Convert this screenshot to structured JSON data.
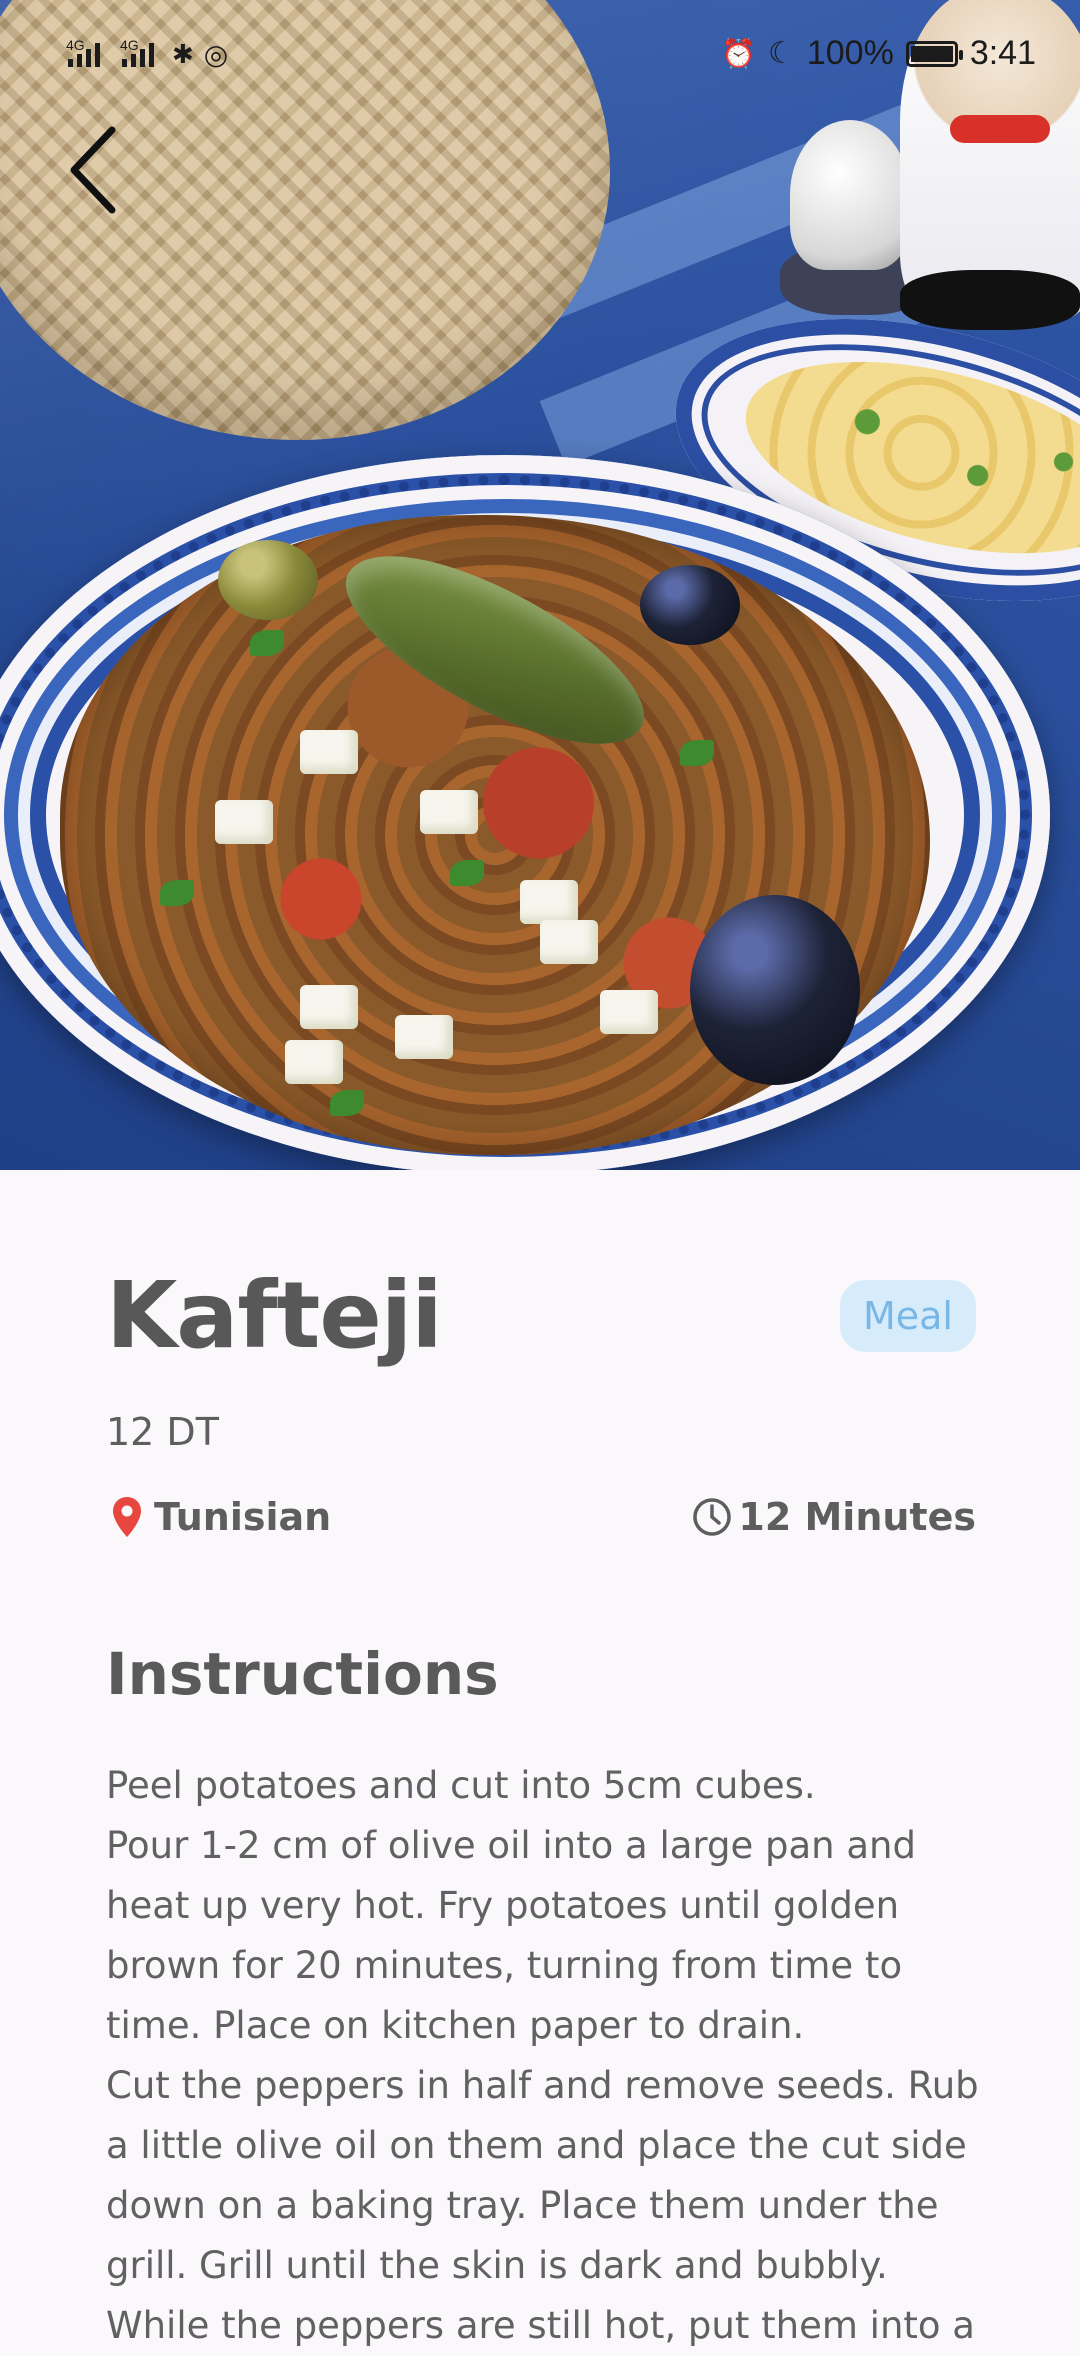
{
  "status_bar": {
    "network_1": "4G",
    "network_2": "4G",
    "battery": "100%",
    "time": "3:41"
  },
  "icons": {
    "back": "chevron-left-icon",
    "location": "map-pin-icon",
    "clock": "clock-icon"
  },
  "colors": {
    "chip_bg": "#d7ecfa",
    "chip_text": "#79b7e6",
    "pin": "#e8473f",
    "text": "#5e5e5e"
  },
  "meal": {
    "name": "Kafteji",
    "category": "Meal",
    "price": "12 DT",
    "area": "Tunisian",
    "duration": "12 Minutes"
  },
  "instructions": {
    "heading": "Instructions",
    "text": "Peel potatoes and cut into 5cm cubes.\nPour 1-2 cm of olive oil into a large pan and heat up very hot. Fry potatoes until golden brown for 20 minutes, turning from time to time. Place on kitchen paper to drain.\nCut the peppers in half and remove seeds. Rub a little olive oil on them and place the cut side down on a baking tray. Place them under the grill. Grill until the skin is dark and bubbly.\nWhile the peppers are still hot, put them into a"
  }
}
